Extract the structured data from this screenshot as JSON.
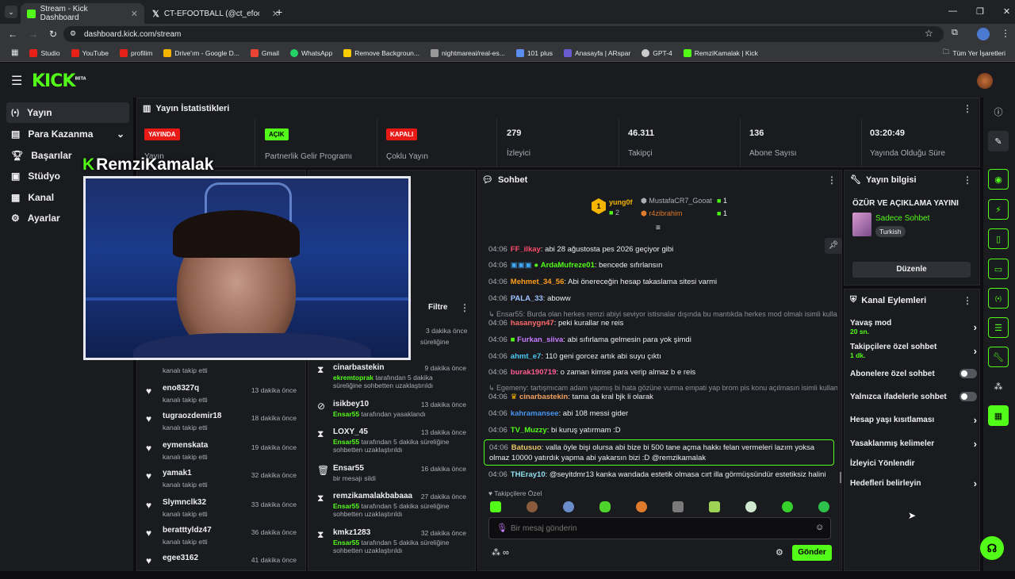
{
  "browser": {
    "tabs": [
      {
        "title": "Stream - Kick Dashboard"
      },
      {
        "title": "CT-EFOOTBALL (@ct_efootball)"
      }
    ],
    "url": "dashboard.kick.com/stream",
    "bookmarks": [
      "Studio",
      "YouTube",
      "profilim",
      "Drive'ım - Google D...",
      "Gmail",
      "WhatsApp",
      "Remove Backgroun...",
      "nightmareai/real-es...",
      "101 plus",
      "Anasayfa | ARspar",
      "GPT-4",
      "RemziKamalak | Kick"
    ],
    "all_bookmarks": "Tüm Yer İşaretleri"
  },
  "kick": {
    "logo": "KICK",
    "beta": "BETA"
  },
  "sidebar": {
    "items": [
      {
        "label": "Yayın"
      },
      {
        "label": "Para Kazanma"
      },
      {
        "label": "Başarılar"
      },
      {
        "label": "Stüdyo"
      },
      {
        "label": "Kanal"
      },
      {
        "label": "Ayarlar"
      }
    ]
  },
  "stats": {
    "title": "Yayın İstatistikleri",
    "items": [
      {
        "badge": "YAYINDA",
        "label": "Yayın",
        "color": "#e91916"
      },
      {
        "badge": "AÇIK",
        "label": "Partnerlik Gelir Programı",
        "color": "#53fc18"
      },
      {
        "badge": "KAPALI",
        "label": "Çoklu Yayın",
        "color": "#e91916"
      },
      {
        "value": "279",
        "label": "İzleyici"
      },
      {
        "value": "46.311",
        "label": "Takipçi"
      },
      {
        "value": "136",
        "label": "Abone Sayısı"
      },
      {
        "value": "03:20:49",
        "label": "Yayında Olduğu Süre"
      }
    ]
  },
  "overlay_name": "RemziKamalak",
  "follows": [
    {
      "name": "eno8327q",
      "sub": "kanalı takip etti",
      "time": "13 dakika önce"
    },
    {
      "name": "tugraozdemir18",
      "sub": "kanalı takip etti",
      "time": "18 dakika önce"
    },
    {
      "name": "eymenskata",
      "sub": "kanalı takip etti",
      "time": "19 dakika önce"
    },
    {
      "name": "yamak1",
      "sub": "kanalı takip etti",
      "time": "32 dakika önce"
    },
    {
      "name": "Slymnclk32",
      "sub": "kanalı takip etti",
      "time": "33 dakika önce"
    },
    {
      "name": "beratttyldz47",
      "sub": "kanalı takip etti",
      "time": "36 dakika önce"
    },
    {
      "name": "egee3162",
      "sub": "",
      "time": "41 dakika önce"
    }
  ],
  "follow_partial": {
    "sub": "kanalı takip etti"
  },
  "activity": {
    "filter": "Filtre",
    "top": {
      "sub": "süreliğine",
      "time": "3 dakika önce"
    },
    "items": [
      {
        "name": "cinarbastekin",
        "mod": "ekremtoprak",
        "rest": "tarafından 5 dakika süreliğine sohbetten uzaklaştırıldı",
        "time": "9 dakika önce"
      },
      {
        "name": "isikbey10",
        "mod": "Ensar55",
        "rest": "tarafından yasaklandı",
        "time": "13 dakika önce"
      },
      {
        "name": "LOXY_45",
        "mod": "Ensar55",
        "rest": "tarafından 5 dakika süreliğine sohbetten uzaklaştırıldı",
        "time": "13 dakika önce"
      },
      {
        "name": "Ensar55",
        "mod": "",
        "rest": "bir mesajı sildi",
        "time": "16 dakika önce"
      },
      {
        "name": "remzikamalakbabaaa",
        "mod": "Ensar55",
        "rest": "tarafından 5 dakika süreliğine sohbetten uzaklaştırıldı",
        "time": "27 dakika önce"
      },
      {
        "name": "kmkz1283",
        "mod": "Ensar55",
        "rest": "tarafından 5 dakika süreliğine sohbetten uzaklaştırıldı",
        "time": "32 dakika önce"
      }
    ]
  },
  "chat": {
    "title": "Sohbet",
    "leaders": {
      "first": "yung0f",
      "first_count": "2",
      "second": "MustafaCR7_Gooat",
      "second_count": "1",
      "third": "r4zibrahim",
      "third_count": "1"
    },
    "messages": [
      {
        "time": "04:06",
        "user": "FF_ilkay",
        "color": "#ff4d6d",
        "text": "abi 28 ağustosta pes 2026 geçiyor gibi"
      },
      {
        "time": "04:06",
        "user": "ArdaMufreze01",
        "color": "#53fc18",
        "text": "bencede sıfırlansın"
      },
      {
        "time": "04:06",
        "user": "Mehmet_34_56",
        "color": "#ff9f1c",
        "text": "Abi önereceğin hesap takaslama sitesi varmi"
      },
      {
        "time": "04:06",
        "user": "PALA_33",
        "color": "#a0c4ff",
        "text": "aboww"
      },
      {
        "time": "04:06",
        "user": "hasanygn47",
        "color": "#ff6b6b",
        "text": "peki kurallar ne reis"
      },
      {
        "time": "04:06",
        "user": "Furkan_siiva",
        "color": "#c77dff",
        "text": "abi sıfırlama gelmesin para yok şimdi"
      },
      {
        "time": "04:06",
        "user": "ahmt_e7",
        "color": "#4cc9f0",
        "text": "110 geni gorcez artık abi suyu çıktı"
      },
      {
        "time": "04:06",
        "user": "burak190719",
        "color": "#ff5d8f",
        "text": "o zaman kimse para verip almaz b e reis"
      },
      {
        "time": "04:06",
        "user": "cinarbastekin",
        "color": "#f4a261",
        "text": "tama da kral bjk li olarak"
      },
      {
        "time": "04:06",
        "user": "kahramansee",
        "color": "#4895ef",
        "text": "abi 108 messi gider"
      },
      {
        "time": "04:06",
        "user": "TV_Muzzy",
        "color": "#53fc18",
        "text": "bi kuruş yatırmam :D"
      },
      {
        "time": "04:06",
        "user": "Batusuo",
        "color": "#e9c46a",
        "text": "valla öyle bişi olursa abi bize bi 500 tane açma hakkı felan vermeleri lazım yoksa olmaz 10000 yatırdık yapma abi yakarsın bizi :D @remzikamalak"
      },
      {
        "time": "04:06",
        "user": "THEray10",
        "color": "#90e0ef",
        "text": "@seyitdmr13 kanka wandada estetik olmasa cırt illa görmüşsündür estetiksiz halini"
      }
    ],
    "reply1": "Ensar55: Burda olan herkes remzi abiyi seviyor istisnalar dışında bu mantıkda herkes mod olmalı isimli kullan...",
    "reply2": "Egemeny: tartışmıcam adam yapmış bi hata gözüne vurma empati yap brom pis konu açılmasın isimli kullan...",
    "emotes_label": "Takipçilere Özel",
    "placeholder": "Bir mesaj gönderin",
    "send": "Gönder"
  },
  "stream_info": {
    "title": "Yayın bilgisi",
    "stream_title": "ÖZÜR VE AÇIKLAMA YAYINI",
    "mode": "Sadece Sohbet",
    "lang": "Turkish",
    "edit": "Düzenle"
  },
  "channel_actions": {
    "title": "Kanal Eylemleri",
    "items": [
      {
        "label": "Yavaş mod",
        "sub": "20 sn.",
        "kind": "chevron"
      },
      {
        "label": "Takipçilere özel sohbet",
        "sub": "1 dk.",
        "kind": "chevron"
      },
      {
        "label": "Abonelere özel sohbet",
        "sub": "",
        "kind": "toggle"
      },
      {
        "label": "Yalnızca ifadelerle sohbet",
        "sub": "",
        "kind": "toggle"
      },
      {
        "label": "Hesap yaşı kısıtlaması",
        "sub": "",
        "kind": "chevron"
      },
      {
        "label": "Yasaklanmış kelimeler",
        "sub": "",
        "kind": "chevron"
      },
      {
        "label": "İzleyici Yönlendir",
        "sub": "",
        "kind": "none"
      },
      {
        "label": "Hedefleri belirleyin",
        "sub": "",
        "kind": "chevron"
      }
    ]
  }
}
